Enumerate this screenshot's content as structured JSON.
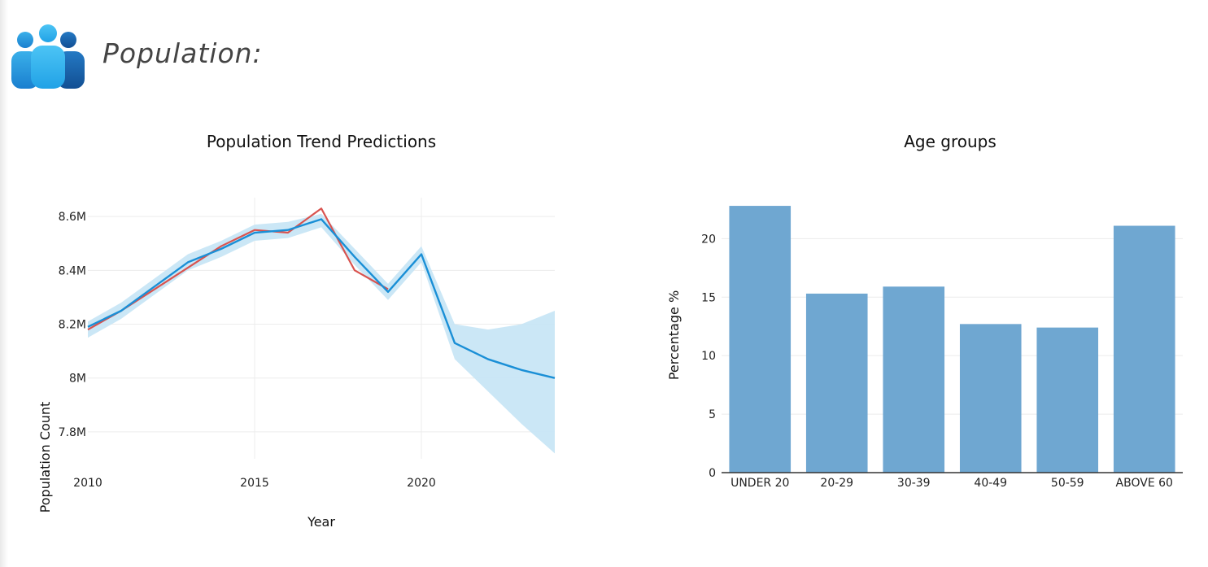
{
  "header": {
    "title": "Population:",
    "icon": "people-group-icon"
  },
  "colors": {
    "forecast_line": "#1a8fd6",
    "forecast_band": "#c8e6f5",
    "actual_line": "#d9534f",
    "bar": "#6fa7d1",
    "icon_light": "#38b6f0",
    "icon_dark": "#1565a8"
  },
  "chart_data": [
    {
      "type": "line",
      "title": "Population Trend Predictions",
      "xlabel": "Year",
      "ylabel": "Population Count",
      "xlim": [
        2010,
        2024
      ],
      "ylim": [
        7.7,
        8.67
      ],
      "x_ticks": [
        2010,
        2015,
        2020
      ],
      "y_ticks": [
        {
          "value": 7.8,
          "label": "7.8M"
        },
        {
          "value": 8.0,
          "label": "8M"
        },
        {
          "value": 8.2,
          "label": "8.2M"
        },
        {
          "value": 8.4,
          "label": "8.4M"
        },
        {
          "value": 8.6,
          "label": "8.6M"
        }
      ],
      "grid": true,
      "series": [
        {
          "role": "forecast",
          "x": [
            2010,
            2011,
            2012,
            2013,
            2014,
            2015,
            2016,
            2017,
            2018,
            2019,
            2020,
            2021,
            2022,
            2023,
            2024
          ],
          "y": [
            8.19,
            8.25,
            8.34,
            8.43,
            8.48,
            8.54,
            8.55,
            8.59,
            8.45,
            8.32,
            8.46,
            8.13,
            8.07,
            8.03,
            8.0
          ]
        },
        {
          "role": "actual",
          "x": [
            2010,
            2011,
            2012,
            2013,
            2014,
            2015,
            2016,
            2017,
            2018,
            2019
          ],
          "y": [
            8.18,
            8.25,
            8.33,
            8.41,
            8.49,
            8.55,
            8.54,
            8.63,
            8.4,
            8.33
          ]
        }
      ],
      "band": {
        "x": [
          2010,
          2011,
          2012,
          2013,
          2014,
          2015,
          2016,
          2017,
          2018,
          2019,
          2020,
          2021,
          2022,
          2023,
          2024
        ],
        "upper": [
          8.21,
          8.28,
          8.37,
          8.46,
          8.51,
          8.57,
          8.58,
          8.61,
          8.48,
          8.35,
          8.49,
          8.2,
          8.18,
          8.2,
          8.25
        ],
        "lower": [
          8.15,
          8.22,
          8.31,
          8.4,
          8.45,
          8.51,
          8.52,
          8.56,
          8.42,
          8.29,
          8.43,
          8.07,
          7.95,
          7.83,
          7.72
        ]
      }
    },
    {
      "type": "bar",
      "title": "Age groups",
      "xlabel": "",
      "ylabel": "Percentage %",
      "ylim": [
        0,
        23.5
      ],
      "y_ticks": [
        0,
        5,
        10,
        15,
        20
      ],
      "grid": true,
      "categories": [
        "UNDER 20",
        "20-29",
        "30-39",
        "40-49",
        "50-59",
        "ABOVE 60"
      ],
      "values": [
        22.8,
        15.3,
        15.9,
        12.7,
        12.4,
        21.1
      ]
    }
  ]
}
